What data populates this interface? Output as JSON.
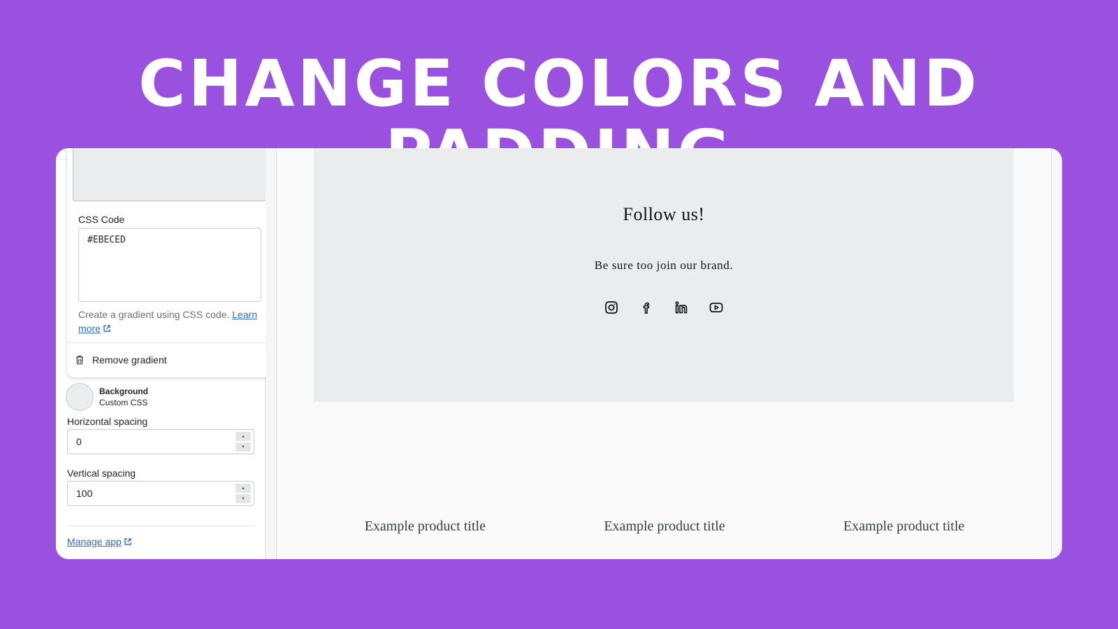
{
  "headline": "CHANGE COLORS AND PADDING",
  "colors": {
    "background": "#9b51e0",
    "section_bg": "#ebeced",
    "link": "#2c6ecb"
  },
  "settings": {
    "css_code_label": "CSS Code",
    "css_code_value": "#EBECED",
    "help_text": "Create a gradient using CSS code.",
    "learn_more_label": "Learn more",
    "remove_gradient_label": "Remove gradient",
    "background": {
      "title": "Background",
      "subtitle": "Custom CSS"
    },
    "horizontal_spacing": {
      "label": "Horizontal spacing",
      "value": "0"
    },
    "vertical_spacing": {
      "label": "Vertical spacing",
      "value": "100"
    },
    "manage_app_label": "Manage app"
  },
  "preview": {
    "follow_title": "Follow us!",
    "follow_subtitle": "Be sure too join our brand.",
    "social_icons": [
      "instagram-icon",
      "facebook-icon",
      "linkedin-icon",
      "youtube-icon"
    ],
    "products": [
      {
        "title": "Example product title"
      },
      {
        "title": "Example product title"
      },
      {
        "title": "Example product title"
      }
    ]
  }
}
